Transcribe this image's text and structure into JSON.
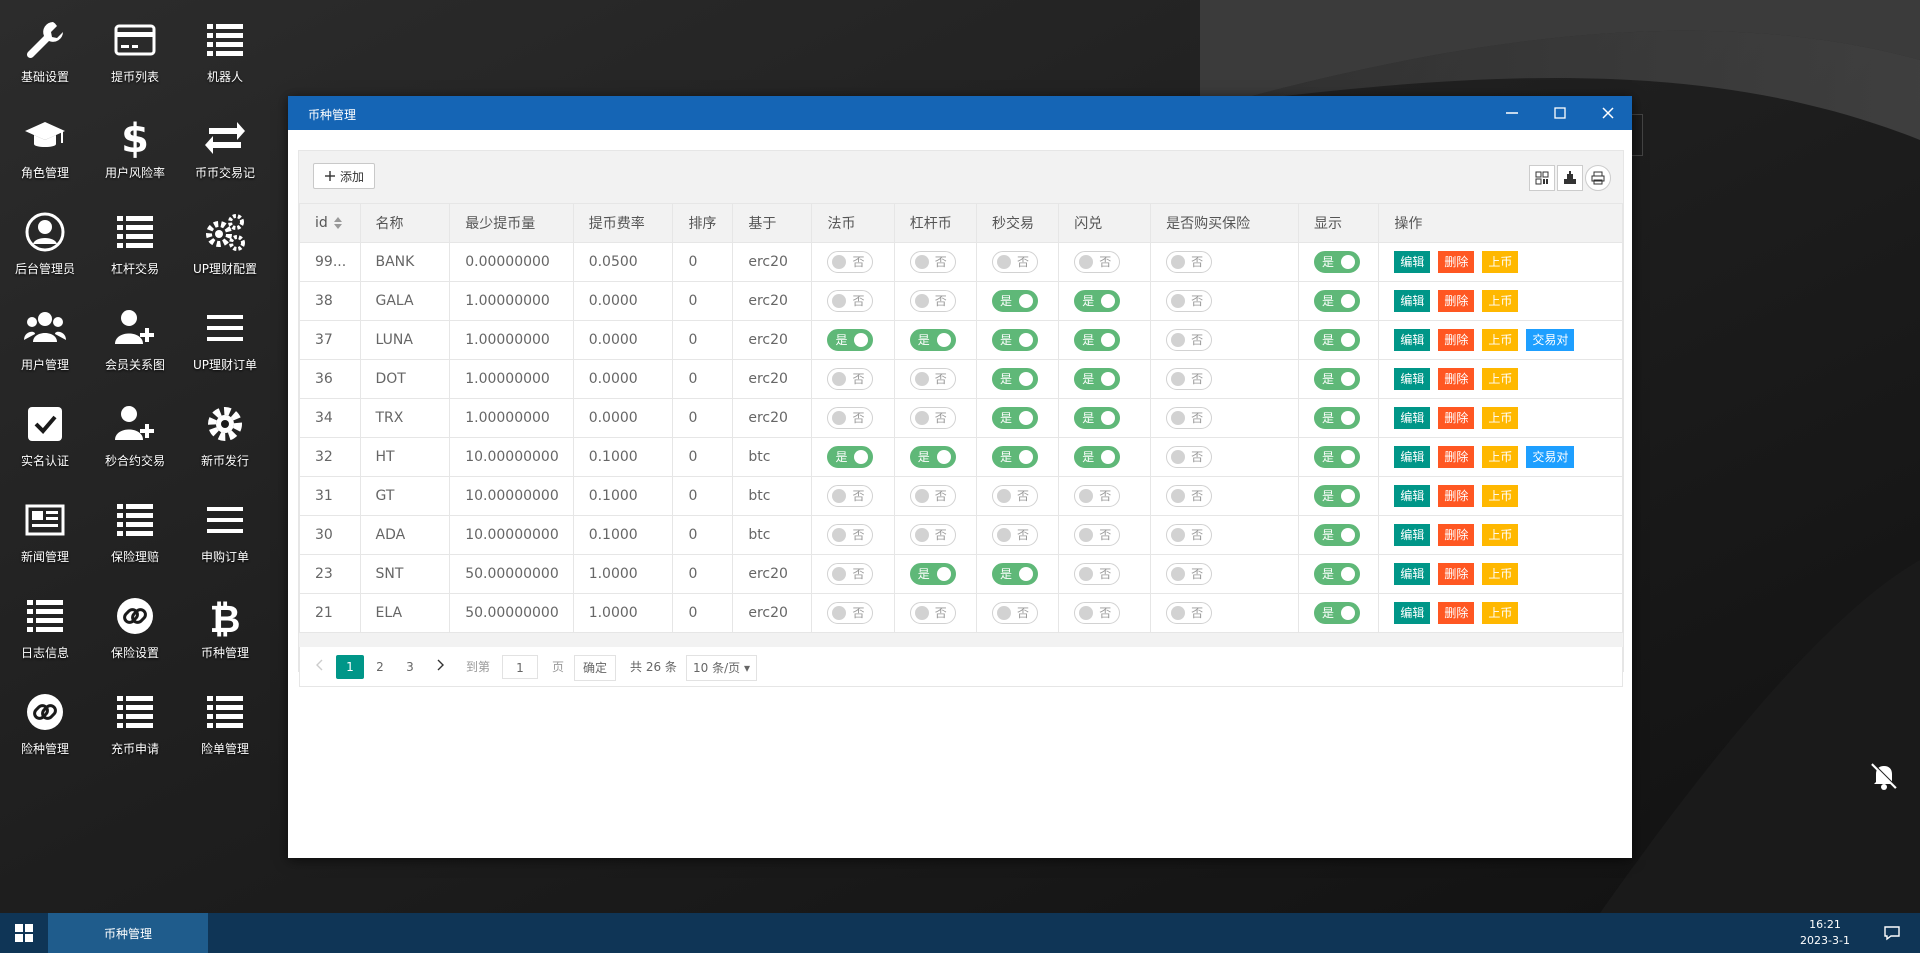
{
  "desktop": {
    "icons": [
      {
        "label": "基础设置",
        "icon": "wrench-icon"
      },
      {
        "label": "提币列表",
        "icon": "card-icon"
      },
      {
        "label": "机器人",
        "icon": "list-icon"
      },
      {
        "label": "角色管理",
        "icon": "graduation-cap-icon"
      },
      {
        "label": "用户风险率",
        "icon": "dollar-icon"
      },
      {
        "label": "币币交易记",
        "icon": "exchange-arrows-icon"
      },
      {
        "label": "后台管理员",
        "icon": "user-circle-icon"
      },
      {
        "label": "杠杆交易",
        "icon": "list-icon"
      },
      {
        "label": "UP理财配置",
        "icon": "gears-icon"
      },
      {
        "label": "用户管理",
        "icon": "users-icon"
      },
      {
        "label": "会员关系图",
        "icon": "user-plus-icon"
      },
      {
        "label": "UP理财订单",
        "icon": "bars-icon"
      },
      {
        "label": "实名认证",
        "icon": "check-square-icon"
      },
      {
        "label": "秒合约交易",
        "icon": "user-plus-icon"
      },
      {
        "label": "新币发行",
        "icon": "gear-icon"
      },
      {
        "label": "新闻管理",
        "icon": "newspaper-icon"
      },
      {
        "label": "保险理赔",
        "icon": "list-icon"
      },
      {
        "label": "申购订单",
        "icon": "bars-icon"
      },
      {
        "label": "日志信息",
        "icon": "list-icon"
      },
      {
        "label": "保险设置",
        "icon": "link-circle-icon"
      },
      {
        "label": "币种管理",
        "icon": "bitcoin-icon"
      },
      {
        "label": "险种管理",
        "icon": "link-circle-icon"
      },
      {
        "label": "充币申请",
        "icon": "list-icon"
      },
      {
        "label": "险单管理",
        "icon": "list-icon"
      }
    ]
  },
  "window": {
    "title": "币种管理",
    "add_label": "添加",
    "columns": [
      "id",
      "名称",
      "最少提币量",
      "提币费率",
      "排序",
      "基于",
      "法币",
      "杠杆币",
      "秒交易",
      "闪兑",
      "是否购买保险",
      "显示",
      "操作"
    ],
    "switch_on": "是",
    "switch_off": "否",
    "actions": {
      "edit": "编辑",
      "delete": "删除",
      "list": "上币",
      "pair": "交易对"
    },
    "rows": [
      {
        "id": "99...",
        "name": "BANK",
        "min": "0.00000000",
        "fee": "0.0500",
        "sort": "0",
        "base": "erc20",
        "fiat": false,
        "lever": false,
        "second": false,
        "flash": false,
        "insure": false,
        "show": true,
        "pair": false
      },
      {
        "id": "38",
        "name": "GALA",
        "min": "1.00000000",
        "fee": "0.0000",
        "sort": "0",
        "base": "erc20",
        "fiat": false,
        "lever": false,
        "second": true,
        "flash": true,
        "insure": false,
        "show": true,
        "pair": false
      },
      {
        "id": "37",
        "name": "LUNA",
        "min": "1.00000000",
        "fee": "0.0000",
        "sort": "0",
        "base": "erc20",
        "fiat": true,
        "lever": true,
        "second": true,
        "flash": true,
        "insure": false,
        "show": true,
        "pair": true
      },
      {
        "id": "36",
        "name": "DOT",
        "min": "1.00000000",
        "fee": "0.0000",
        "sort": "0",
        "base": "erc20",
        "fiat": false,
        "lever": false,
        "second": true,
        "flash": true,
        "insure": false,
        "show": true,
        "pair": false
      },
      {
        "id": "34",
        "name": "TRX",
        "min": "1.00000000",
        "fee": "0.0000",
        "sort": "0",
        "base": "erc20",
        "fiat": false,
        "lever": false,
        "second": true,
        "flash": true,
        "insure": false,
        "show": true,
        "pair": false
      },
      {
        "id": "32",
        "name": "HT",
        "min": "10.00000000",
        "fee": "0.1000",
        "sort": "0",
        "base": "btc",
        "fiat": true,
        "lever": true,
        "second": true,
        "flash": true,
        "insure": false,
        "show": true,
        "pair": true
      },
      {
        "id": "31",
        "name": "GT",
        "min": "10.00000000",
        "fee": "0.1000",
        "sort": "0",
        "base": "btc",
        "fiat": false,
        "lever": false,
        "second": false,
        "flash": false,
        "insure": false,
        "show": true,
        "pair": false
      },
      {
        "id": "30",
        "name": "ADA",
        "min": "10.00000000",
        "fee": "0.1000",
        "sort": "0",
        "base": "btc",
        "fiat": false,
        "lever": false,
        "second": false,
        "flash": false,
        "insure": false,
        "show": true,
        "pair": false
      },
      {
        "id": "23",
        "name": "SNT",
        "min": "50.00000000",
        "fee": "1.0000",
        "sort": "0",
        "base": "erc20",
        "fiat": false,
        "lever": true,
        "second": true,
        "flash": false,
        "insure": false,
        "show": true,
        "pair": false
      },
      {
        "id": "21",
        "name": "ELA",
        "min": "50.00000000",
        "fee": "1.0000",
        "sort": "0",
        "base": "erc20",
        "fiat": false,
        "lever": false,
        "second": false,
        "flash": false,
        "insure": false,
        "show": true,
        "pair": false
      }
    ],
    "pager": {
      "pages": [
        "1",
        "2",
        "3"
      ],
      "current": "1",
      "goto_label": "到第",
      "goto_value": "1",
      "page_unit": "页",
      "confirm": "确定",
      "total": "共 26 条",
      "per_page": "10 条/页"
    }
  },
  "taskbar": {
    "task_label": "币种管理",
    "time": "16:21",
    "date": "2023-3-1"
  },
  "colors": {
    "titlebar": "#1565b5",
    "switch_on": "#5fb878",
    "edit": "#009688",
    "delete": "#ff5722",
    "list": "#ffb800",
    "pair": "#1e9fff",
    "taskbar": "#0f3556"
  }
}
